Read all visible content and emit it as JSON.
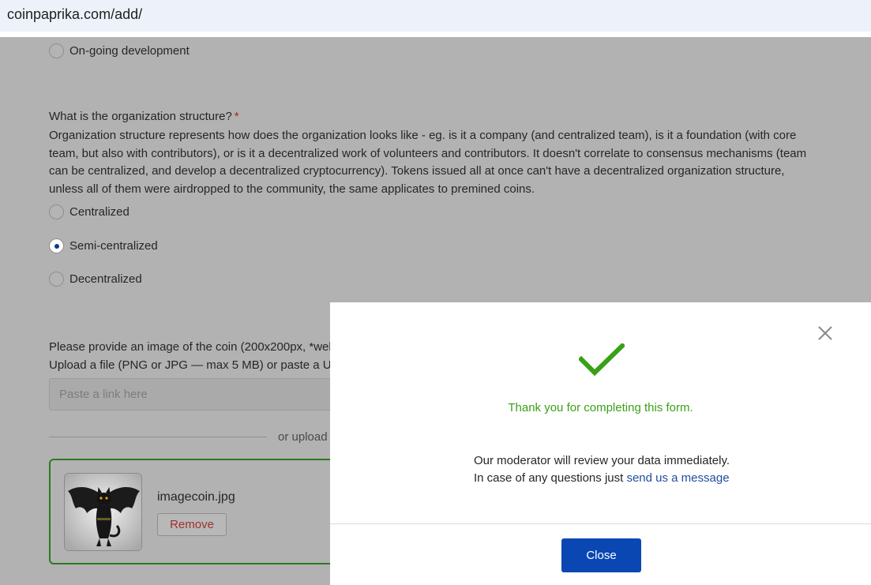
{
  "browser": {
    "url": "coinpaprika.com/add/"
  },
  "form": {
    "dev_option": "On-going development",
    "org_question": "What is the organization structure?",
    "required_mark": "*",
    "org_description": "Organization structure represents how does the organization looks like - eg. is it a company (and centralized team), is it a foundation (with core team, but also with contributors), or is it a decentralized work of volunteers and contributors. It doesn't correlate to consensus mechanisms (team can be centralized, and develop a decentralized cryptocurrency). Tokens issued all at once can't have a decentralized organization structure, unless all of them were airdropped to the community, the same applicates to premined coins.",
    "org_options": [
      {
        "label": "Centralized",
        "checked": false
      },
      {
        "label": "Semi-centralized",
        "checked": true
      },
      {
        "label": "Decentralized",
        "checked": false
      }
    ],
    "image_question_line1": "Please provide an image of the coin (200x200px, *wel",
    "image_question_line2": "Upload a file (PNG or JPG — max 5 MB) or paste a U",
    "link_placeholder": "Paste a link here",
    "or_upload": "or upload",
    "uploaded_file": "imagecoin.jpg",
    "remove_label": "Remove"
  },
  "modal": {
    "thanks": "Thank you for completing this form.",
    "message_line1": "Our moderator will review your data immediately.",
    "message_line2_prefix": "In case of any questions just ",
    "message_link": "send us a message",
    "close_label": "Close"
  },
  "colors": {
    "overlay": "#b2b2b2",
    "success_green": "#3aa017",
    "primary_button": "#0a47b3",
    "upload_border": "#2a7a1f"
  }
}
